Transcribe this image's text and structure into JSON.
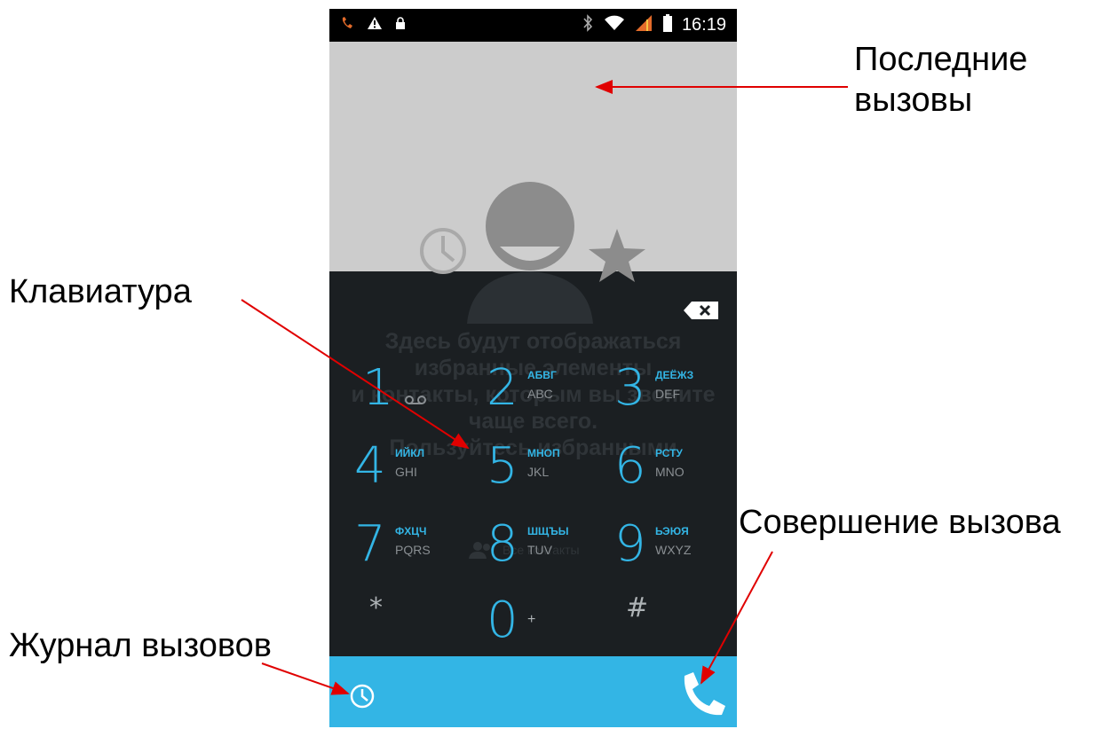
{
  "statusbar": {
    "time": "16:19",
    "icons": [
      "missed-call-icon",
      "warning-icon",
      "lock-icon",
      "bluetooth-icon",
      "wifi-icon",
      "signal-icon",
      "battery-icon"
    ]
  },
  "placeholder": {
    "message_lines": [
      "Здесь будут отображаться",
      "избранные элементы",
      "и контакты, которым вы звоните",
      "чаще всего.",
      "Пользуйтесь избранными"
    ],
    "link": "Все контакты"
  },
  "keypad": [
    {
      "digit": "1",
      "cyr": "",
      "lat": "",
      "extra_icon": "voicemail-icon"
    },
    {
      "digit": "2",
      "cyr": "АБВГ",
      "lat": "ABC"
    },
    {
      "digit": "3",
      "cyr": "ДЕЁЖЗ",
      "lat": "DEF"
    },
    {
      "digit": "4",
      "cyr": "ИЙКЛ",
      "lat": "GHI"
    },
    {
      "digit": "5",
      "cyr": "МНОП",
      "lat": "JKL"
    },
    {
      "digit": "6",
      "cyr": "РСТУ",
      "lat": "MNO"
    },
    {
      "digit": "7",
      "cyr": "ФХЦЧ",
      "lat": "PQRS"
    },
    {
      "digit": "8",
      "cyr": "ШЩЪЫ",
      "lat": "TUV"
    },
    {
      "digit": "9",
      "cyr": "ЬЭЮЯ",
      "lat": "WXYZ"
    },
    {
      "symbol": "*"
    },
    {
      "digit": "0",
      "plus": "+"
    },
    {
      "symbol": "#"
    }
  ],
  "colors": {
    "accent": "#33b5e5",
    "dialpad_bg": "#1b1f22",
    "recent_bg": "#cccccc",
    "arrow": "#e00000"
  },
  "callouts": {
    "recent_calls_line1": "Последние",
    "recent_calls_line2": "вызовы",
    "keyboard": "Клавиатура",
    "make_call": "Совершение вызова",
    "call_log": "Журнал вызовов"
  }
}
